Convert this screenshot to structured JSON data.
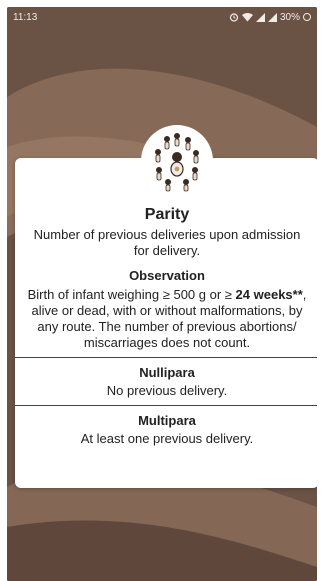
{
  "status_bar": {
    "time": "11:13",
    "battery": "30%",
    "icons": [
      "alarm-icon",
      "wifi-icon",
      "signal-icon",
      "signal-icon",
      "battery-icon"
    ]
  },
  "card": {
    "title": "Parity",
    "subtitle": "Number of previous deliveries upon admission for delivery.",
    "observation": {
      "heading": "Observation",
      "text_before": "Birth of infant weighing ≥ 500 g or ≥ ",
      "text_bold": "24 weeks**",
      "text_after": ", alive or dead, with or without malformations, by any route. The number of previous abortions/ miscarriages does not count."
    },
    "options": [
      {
        "label": "Nullipara",
        "description": "No previous delivery."
      },
      {
        "label": "Multipara",
        "description": "At least one previous delivery."
      }
    ]
  },
  "colors": {
    "background_dark": "#6b5446",
    "background_wave": "#8a6c5a",
    "card": "#ffffff"
  }
}
